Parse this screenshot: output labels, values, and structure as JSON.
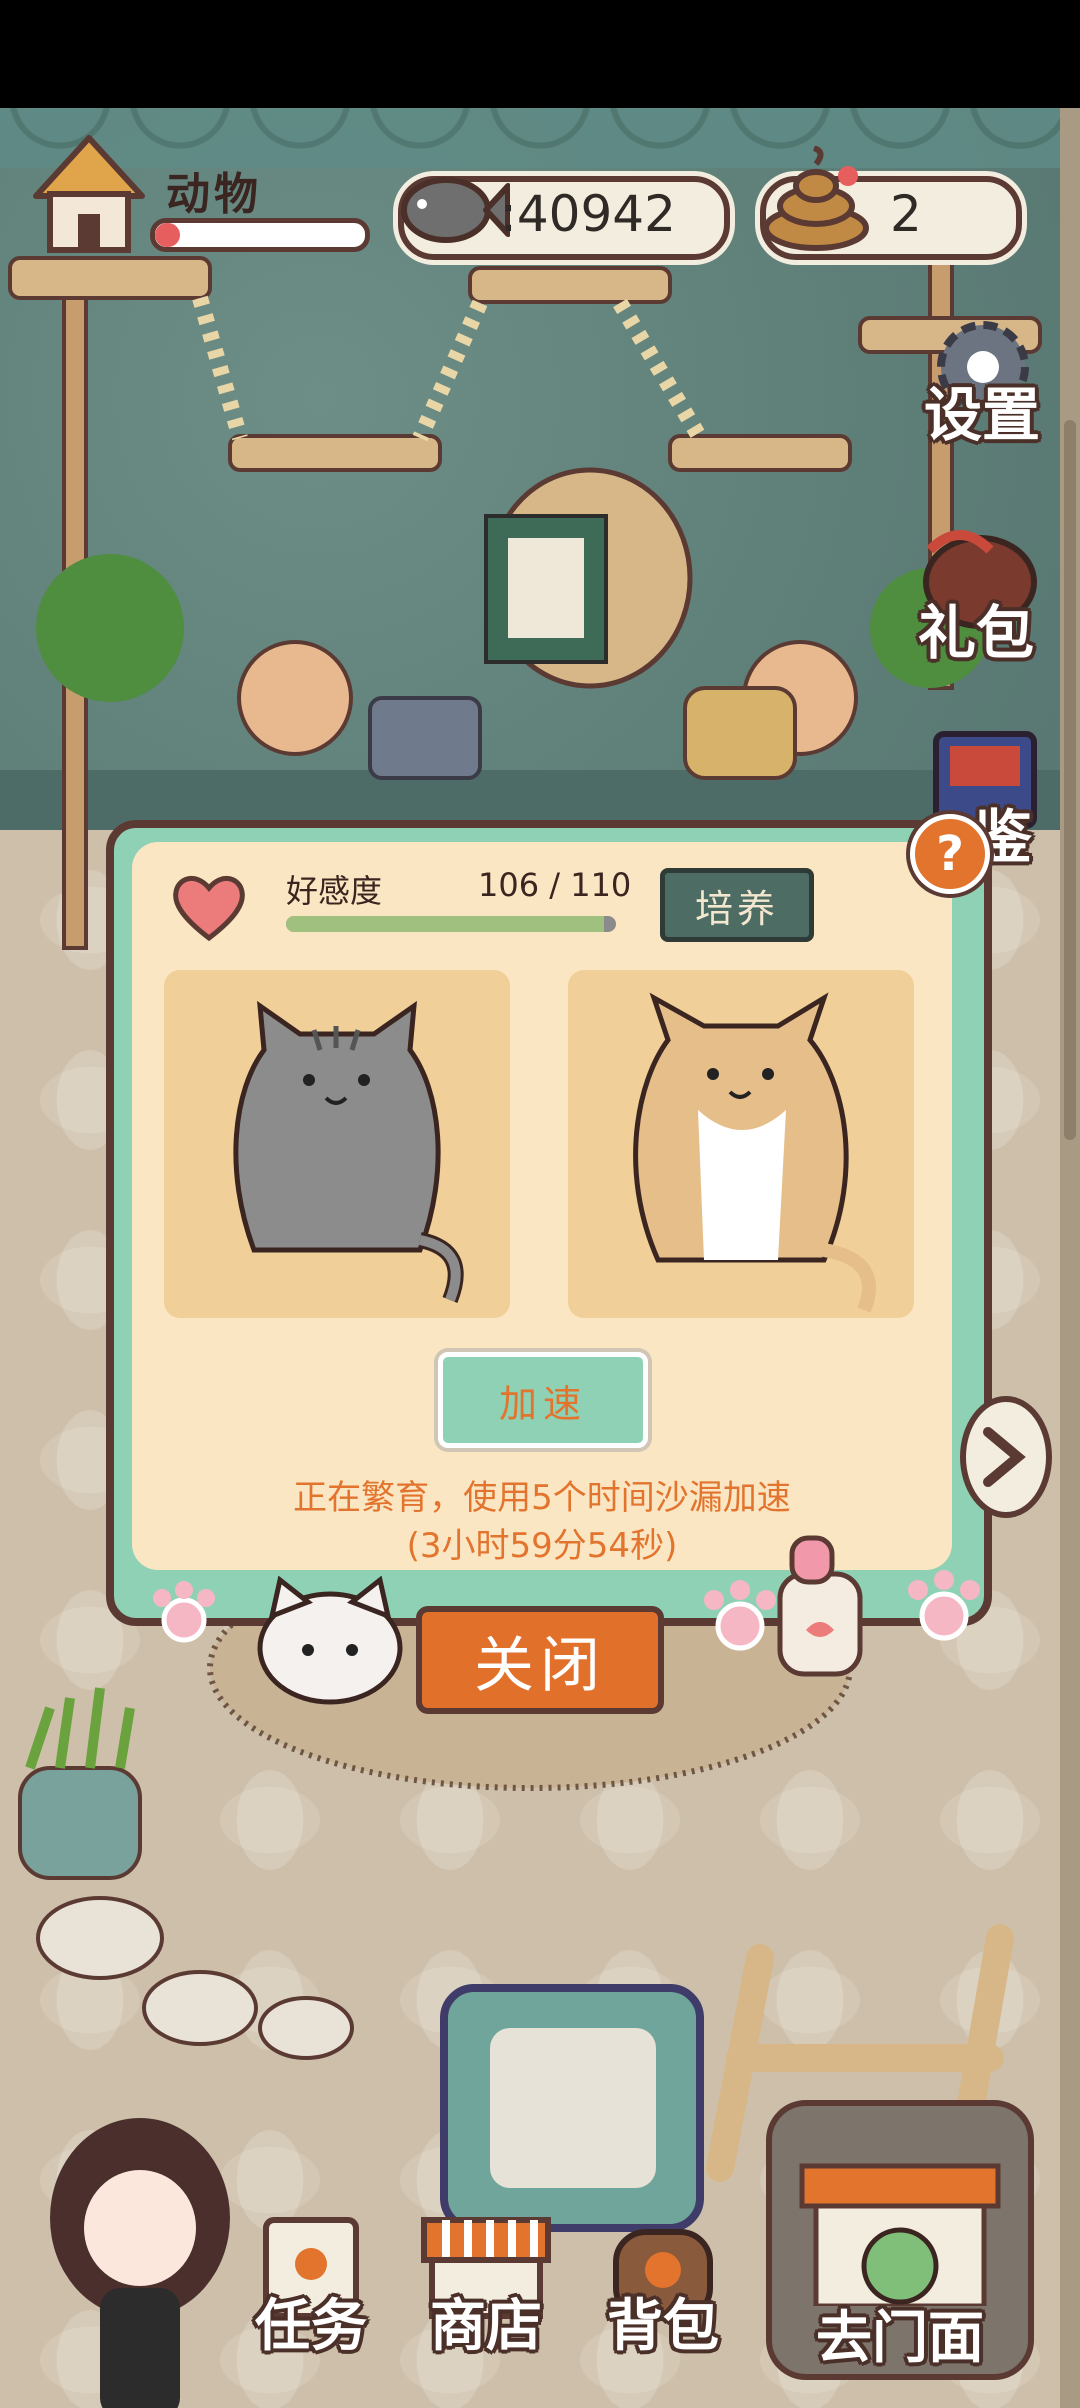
{
  "hud": {
    "level_label": "动物",
    "level_progress": 0.12,
    "fish_count": ":40942",
    "poop_count": "2"
  },
  "side_menu": {
    "settings": "设置",
    "gift": "礼包",
    "guide": "鉴"
  },
  "modal": {
    "help": "?",
    "affection_label": "好感度",
    "affection_value": "106 / 110",
    "affection_progress": 0.964,
    "train_button": "培养",
    "speedup_button": "加速",
    "breeding_message": "正在繁育，使用5个时间沙漏加速",
    "breeding_time": "(3小时59分54秒)",
    "close_button": "关闭"
  },
  "bottom_nav": {
    "tasks": "任务",
    "shop": "商店",
    "backpack": "背包",
    "storefront": "去门面"
  },
  "colors": {
    "accent_orange": "#e2742d",
    "panel_mint": "#8fd1b5",
    "panel_cream": "#fbe6c4",
    "outline_brown": "#5b3a33"
  }
}
